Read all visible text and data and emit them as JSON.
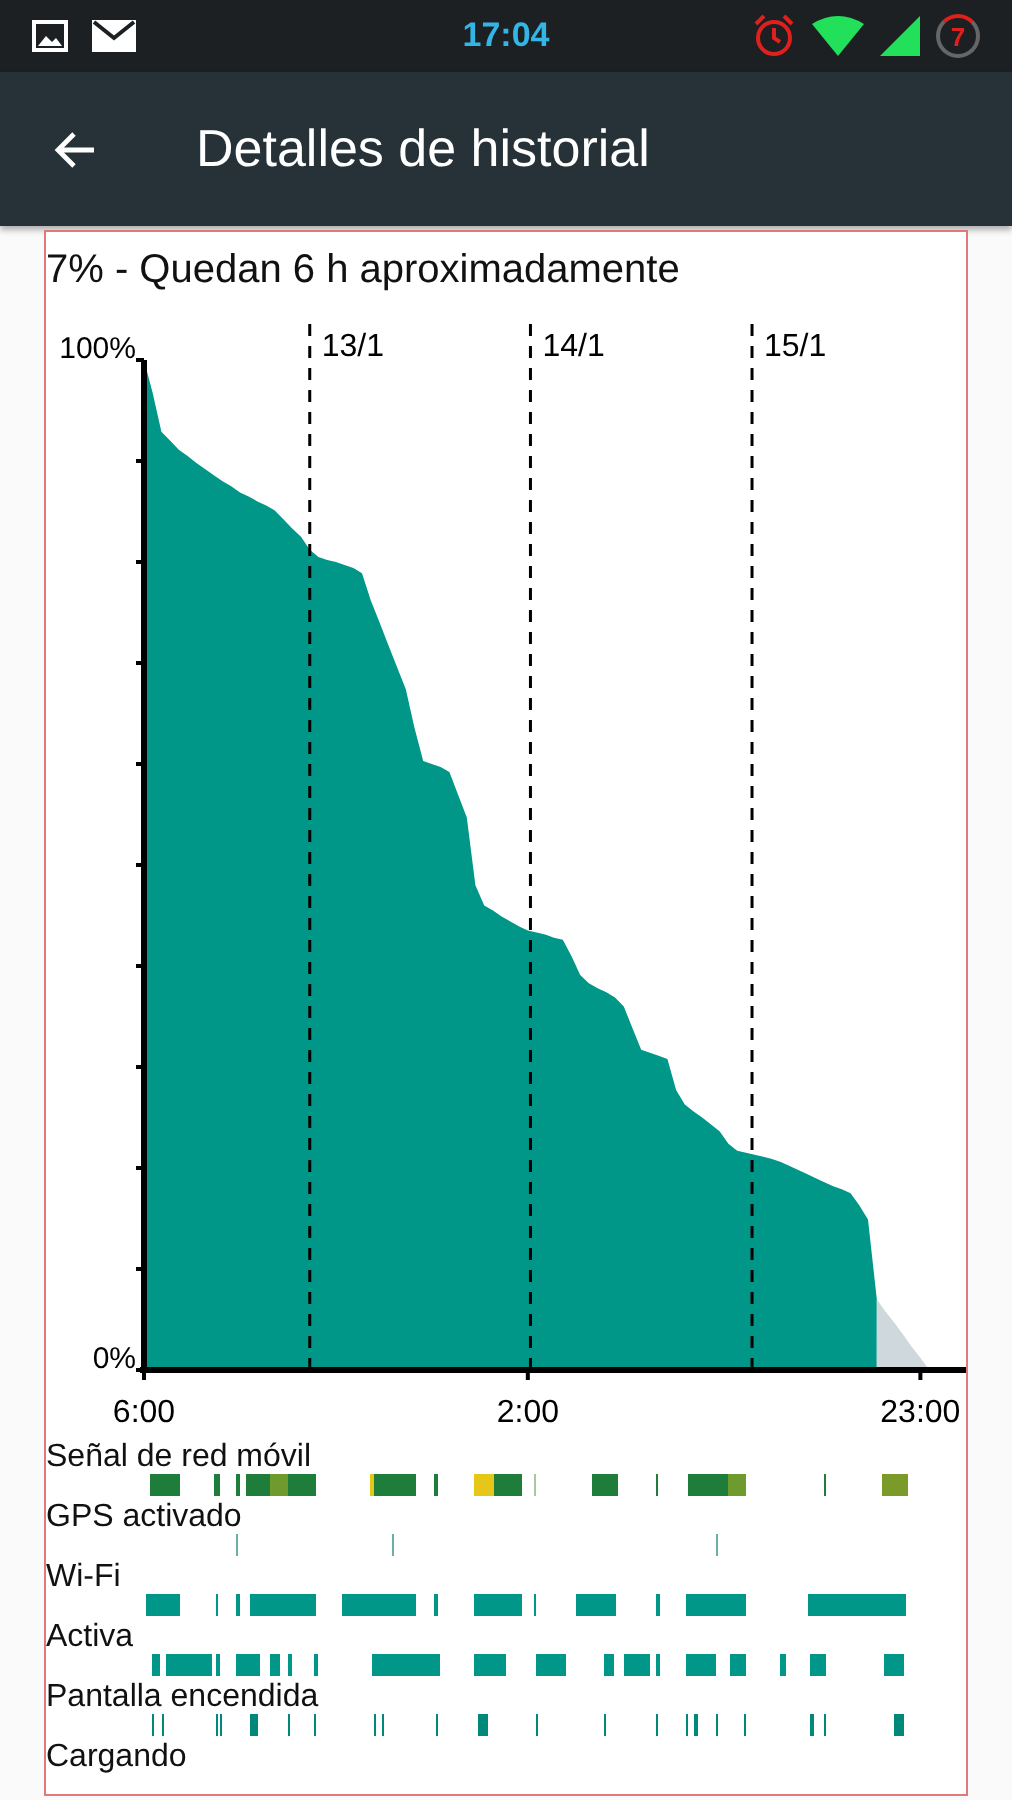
{
  "status_bar": {
    "time": "17:04",
    "battery": "7"
  },
  "app_bar": {
    "title": "Detalles de historial"
  },
  "summary": "7% - Quedan 6 h aproximadamente",
  "chart_data": {
    "type": "area",
    "categories": [
      "6:00",
      null,
      null,
      null,
      null,
      null,
      null,
      null,
      null,
      null,
      null,
      null,
      null,
      null,
      null,
      null,
      null,
      null,
      null,
      null,
      null,
      null,
      null,
      null,
      null,
      null,
      null,
      null,
      null,
      null,
      null,
      null,
      null,
      null,
      null,
      null,
      null,
      null,
      null,
      null,
      null,
      null,
      null,
      null,
      "2:00",
      null,
      null,
      null,
      null,
      null,
      null,
      null,
      null,
      null,
      null,
      null,
      null,
      null,
      null,
      null,
      null,
      null,
      null,
      null,
      null,
      null,
      null,
      null,
      null,
      null,
      null,
      null,
      null,
      null,
      null,
      null,
      null,
      null,
      null,
      null,
      null,
      null,
      null,
      null,
      null,
      null,
      null,
      null,
      null,
      "23:00",
      null
    ],
    "series": [
      {
        "color": "#009688",
        "values": [
          100,
          96.7,
          92.9,
          92.0,
          91.1,
          90.5,
          89.8,
          89.2,
          88.6,
          88.0,
          87.5,
          86.9,
          86.5,
          86.0,
          85.6,
          85.1,
          84.2,
          83.3,
          82.5,
          81.2,
          80.5,
          80.2,
          80.0,
          79.7,
          79.4,
          78.9,
          76.2,
          74.0,
          71.8,
          69.6,
          67.4,
          63.6,
          60.3,
          60.0,
          59.7,
          59.2,
          57.0,
          54.7,
          48.0,
          46.0,
          45.5,
          44.9,
          44.4,
          43.9,
          43.5,
          43.3,
          43.1,
          42.8,
          42.6,
          41.0,
          39.1,
          38.3,
          37.8,
          37.4,
          36.9,
          36.0,
          33.8,
          31.7,
          31.4,
          31.1,
          30.8,
          27.7,
          26.3,
          25.6,
          25.0,
          24.3,
          23.6,
          22.4,
          21.7,
          21.5,
          21.3,
          21.1,
          20.9,
          20.6,
          20.2,
          19.8,
          19.4,
          19.0,
          18.6,
          18.2,
          17.9,
          17.5,
          16.3,
          14.9,
          7,
          null,
          null,
          null,
          null,
          null,
          null
        ]
      },
      {
        "color": "#cfd8dc",
        "values": [
          null,
          null,
          null,
          null,
          null,
          null,
          null,
          null,
          null,
          null,
          null,
          null,
          null,
          null,
          null,
          null,
          null,
          null,
          null,
          null,
          null,
          null,
          null,
          null,
          null,
          null,
          null,
          null,
          null,
          null,
          null,
          null,
          null,
          null,
          null,
          null,
          null,
          null,
          null,
          null,
          null,
          null,
          null,
          null,
          null,
          null,
          null,
          null,
          null,
          null,
          null,
          null,
          null,
          null,
          null,
          null,
          null,
          null,
          null,
          null,
          null,
          null,
          null,
          null,
          null,
          null,
          null,
          null,
          null,
          null,
          null,
          null,
          null,
          null,
          null,
          null,
          null,
          null,
          null,
          null,
          null,
          null,
          null,
          null,
          7,
          5.8,
          4.7,
          3.5,
          2.3,
          1.2,
          0
        ]
      }
    ],
    "ylim": [
      0,
      100
    ],
    "yticks": [
      {
        "value": 0,
        "label": "0%"
      },
      {
        "value": 100,
        "label": "100%"
      }
    ],
    "annotations": [
      "13/1",
      "14/1",
      "15/1"
    ]
  },
  "tracks": [
    {
      "label": "Señal de red móvil"
    },
    {
      "label": "GPS activado"
    },
    {
      "label": "Wi-Fi"
    },
    {
      "label": "Activa"
    },
    {
      "label": "Pantalla encendida"
    },
    {
      "label": "Cargando"
    }
  ]
}
